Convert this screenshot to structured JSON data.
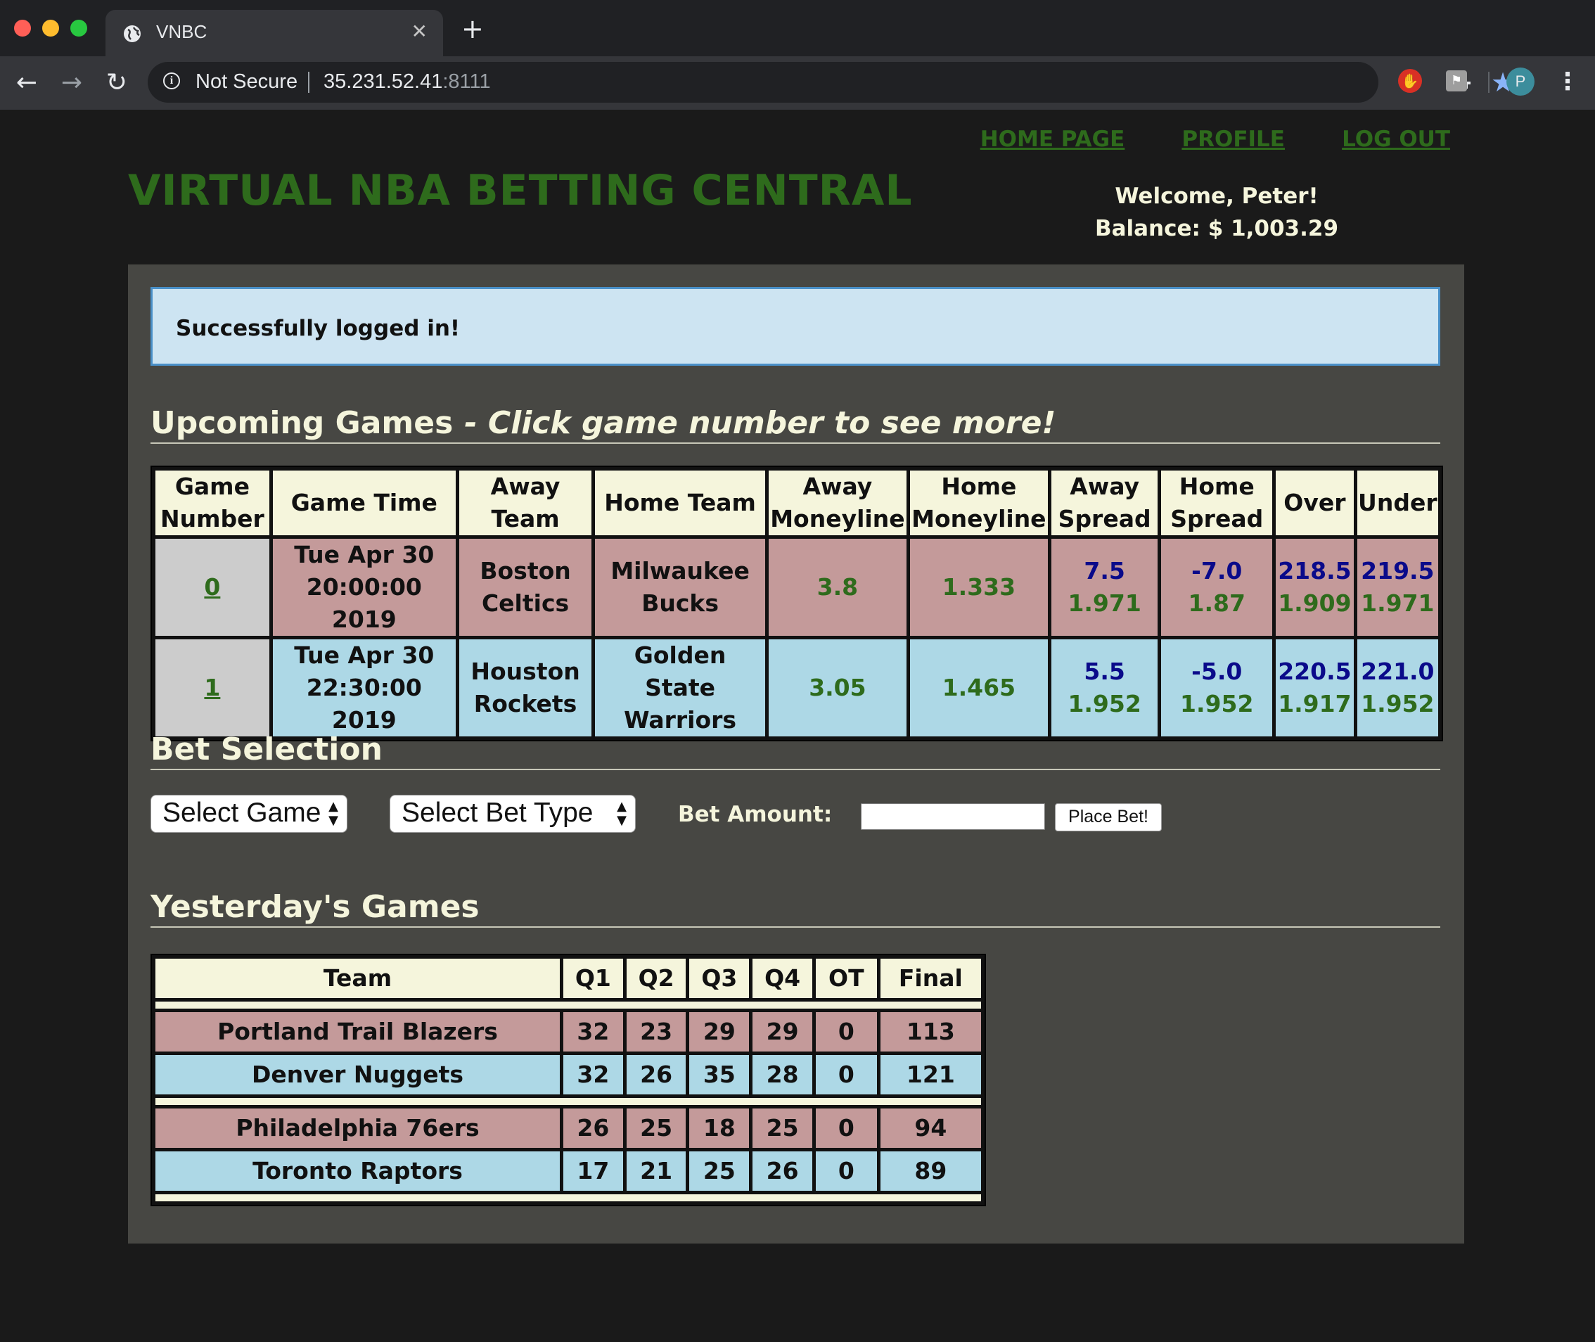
{
  "browser": {
    "tab_title": "VNBC",
    "security_label": "Not Secure",
    "url_host": "35.231.52.41",
    "url_port": ":8111",
    "profile_initial": "P"
  },
  "site": {
    "nav": {
      "home": "HOME PAGE",
      "profile": "PROFILE",
      "logout": "LOG OUT"
    },
    "title": "VIRTUAL NBA BETTING CENTRAL",
    "welcome": "Welcome, Peter!",
    "balance": "Balance: $ 1,003.29",
    "flash_message": "Successfully logged in!"
  },
  "upcoming": {
    "title": "Upcoming Games",
    "hint": "- Click game number to see more!",
    "headers": {
      "game_number": [
        "Game",
        "Number"
      ],
      "game_time": "Game Time",
      "away_team": [
        "Away",
        "Team"
      ],
      "home_team": "Home Team",
      "away_moneyline": [
        "Away",
        "Moneyline"
      ],
      "home_moneyline": [
        "Home",
        "Moneyline"
      ],
      "away_spread": [
        "Away",
        "Spread"
      ],
      "home_spread": [
        "Home",
        "Spread"
      ],
      "over": "Over",
      "under": "Under"
    },
    "games": [
      {
        "number": "0",
        "time_line1": "Tue Apr 30",
        "time_line2": "20:00:00 2019",
        "away_line1": "Boston",
        "away_line2": "Celtics",
        "home_line1": "Milwaukee",
        "home_line2": "Bucks",
        "away_moneyline": "3.8",
        "home_moneyline": "1.333",
        "away_spread": "7.5",
        "away_spread_odds": "1.971",
        "home_spread": "-7.0",
        "home_spread_odds": "1.87",
        "over": "218.5",
        "over_odds": "1.909",
        "under": "219.5",
        "under_odds": "1.971"
      },
      {
        "number": "1",
        "time_line1": "Tue Apr 30",
        "time_line2": "22:30:00 2019",
        "away_line1": "Houston",
        "away_line2": "Rockets",
        "home_line1": "Golden State",
        "home_line2": "Warriors",
        "away_moneyline": "3.05",
        "home_moneyline": "1.465",
        "away_spread": "5.5",
        "away_spread_odds": "1.952",
        "home_spread": "-5.0",
        "home_spread_odds": "1.952",
        "over": "220.5",
        "over_odds": "1.917",
        "under": "221.0",
        "under_odds": "1.952"
      }
    ]
  },
  "bet_selection": {
    "title": "Bet Selection",
    "select_game": "Select Game",
    "select_bet_type": "Select Bet Type",
    "amount_label": "Bet Amount:",
    "amount_value": "",
    "place_button": "Place Bet!"
  },
  "yesterday": {
    "title": "Yesterday's Games",
    "headers": [
      "Team",
      "Q1",
      "Q2",
      "Q3",
      "Q4",
      "OT",
      "Final"
    ],
    "games": [
      {
        "away": {
          "team": "Portland Trail Blazers",
          "q1": "32",
          "q2": "23",
          "q3": "29",
          "q4": "29",
          "ot": "0",
          "final": "113"
        },
        "home": {
          "team": "Denver Nuggets",
          "q1": "32",
          "q2": "26",
          "q3": "35",
          "q4": "28",
          "ot": "0",
          "final": "121"
        }
      },
      {
        "away": {
          "team": "Philadelphia 76ers",
          "q1": "26",
          "q2": "25",
          "q3": "18",
          "q4": "25",
          "ot": "0",
          "final": "94"
        },
        "home": {
          "team": "Toronto Raptors",
          "q1": "17",
          "q2": "21",
          "q3": "25",
          "q4": "26",
          "ot": "0",
          "final": "89"
        }
      }
    ]
  },
  "colors": {
    "title_green": "#2e6b1c",
    "cream": "#f5f5dc",
    "away_row": "#c49a9a",
    "home_row": "#add8e6",
    "odds_navy": "#0a0a8a"
  }
}
